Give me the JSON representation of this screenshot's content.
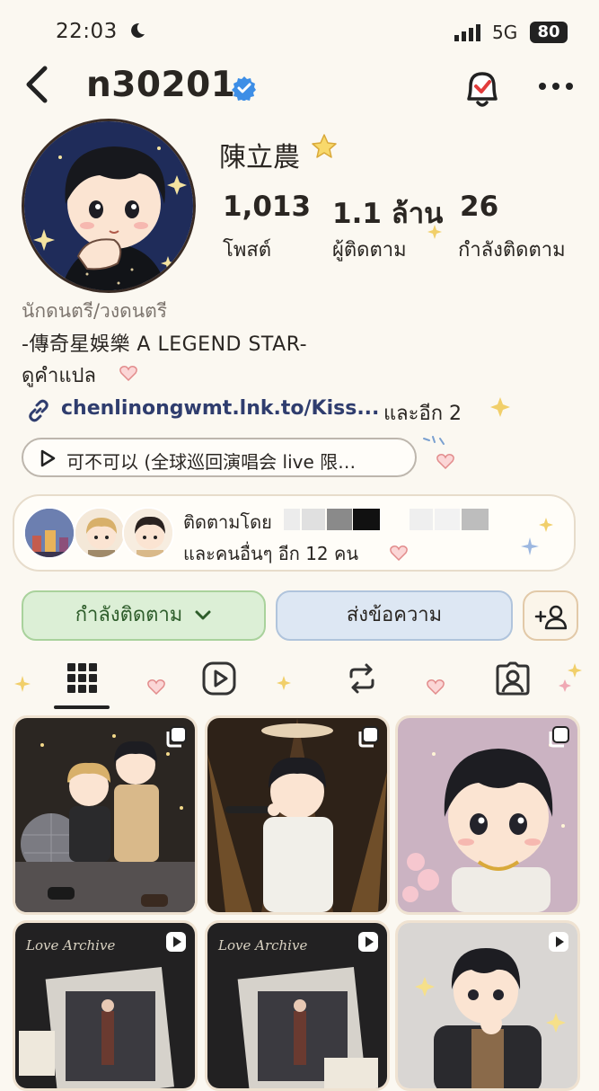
{
  "status_bar": {
    "time": "22:03",
    "network": "5G",
    "battery": "80",
    "icons": [
      "moon-icon",
      "signal-icon"
    ]
  },
  "header": {
    "username": "n30201",
    "icons": [
      "back-icon",
      "verified-icon",
      "bell-icon",
      "more-icon"
    ]
  },
  "profile": {
    "display_name": "陳立農",
    "stats": [
      {
        "value": "1,013",
        "label": "โพสต์"
      },
      {
        "value": "1.1 ล้าน",
        "label": "ผู้ติดตาม"
      },
      {
        "value": "26",
        "label": "กำลังติดตาม"
      }
    ],
    "category": "นักดนตรี/วงดนตรี",
    "bio_line": "-傳奇星娛樂 A LEGEND STAR-",
    "translate": "ดูคำแปล",
    "link": "chenlinongwmt.lnk.to/Kiss...",
    "link_more": "และอีก 2",
    "music": "可不可以 (全球巡回演唱会 live 限…"
  },
  "followed_by": {
    "line1": "ติดตามโดย",
    "line2": "และคนอื่นๆ อีก 12 คน"
  },
  "actions": {
    "following": "กำลังติดตาม",
    "message": "ส่งข้อความ"
  },
  "tabs": [
    "grid-icon",
    "reels-icon",
    "repost-icon",
    "tagged-icon"
  ],
  "posts": [
    {
      "kind": "carousel"
    },
    {
      "kind": "carousel"
    },
    {
      "kind": "carousel"
    },
    {
      "kind": "reel",
      "text": "Love Archive"
    },
    {
      "kind": "reel",
      "text": "Love Archive"
    },
    {
      "kind": "reel"
    }
  ],
  "colors": {
    "background": "#fbf8f1",
    "verified": "#3d8ee6",
    "bell_check": "#e23c3c",
    "following_btn": "#dcefd6",
    "message_btn": "#dde7f3",
    "link": "#2f3d6e"
  }
}
